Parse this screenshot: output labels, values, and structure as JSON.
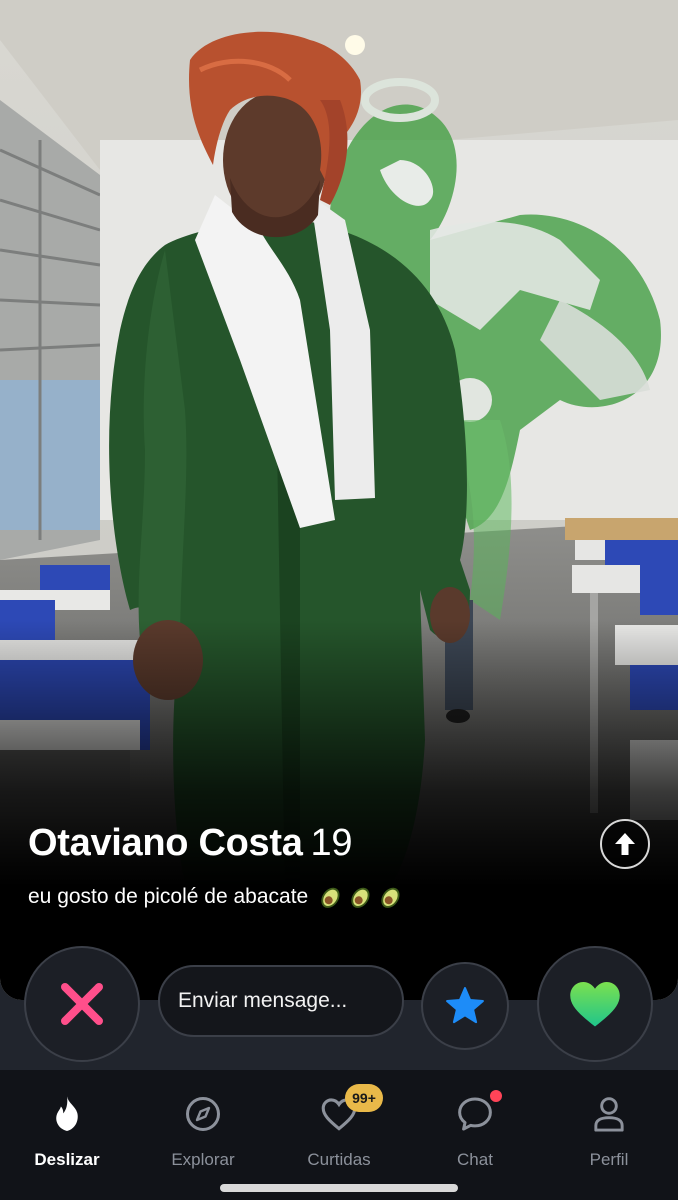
{
  "profile": {
    "name": "Otaviano Costa",
    "age": "19",
    "bio": "eu gosto de picolé de abacate",
    "bio_emoji": [
      "avocado",
      "avocado",
      "avocado"
    ]
  },
  "actions": {
    "message_placeholder": "Enviar mensage...",
    "nope_icon": "x-icon",
    "superlike_icon": "star-icon",
    "like_icon": "heart-icon",
    "expand_icon": "arrow-up-icon"
  },
  "nav": {
    "items": [
      {
        "label": "Deslizar",
        "icon": "flame-icon",
        "active": true
      },
      {
        "label": "Explorar",
        "icon": "compass-icon",
        "active": false
      },
      {
        "label": "Curtidas",
        "icon": "heart-outline-icon",
        "active": false
      },
      {
        "label": "Chat",
        "icon": "chat-bubble-icon",
        "active": false
      },
      {
        "label": "Perfil",
        "icon": "person-icon",
        "active": false
      }
    ],
    "likes_badge": "99+"
  },
  "colors": {
    "nope": "#ff4f8b",
    "superlike": "#1d8cf8",
    "like": "#4cd964",
    "badge": "#e9b949",
    "chat_dot": "#ff4458"
  }
}
